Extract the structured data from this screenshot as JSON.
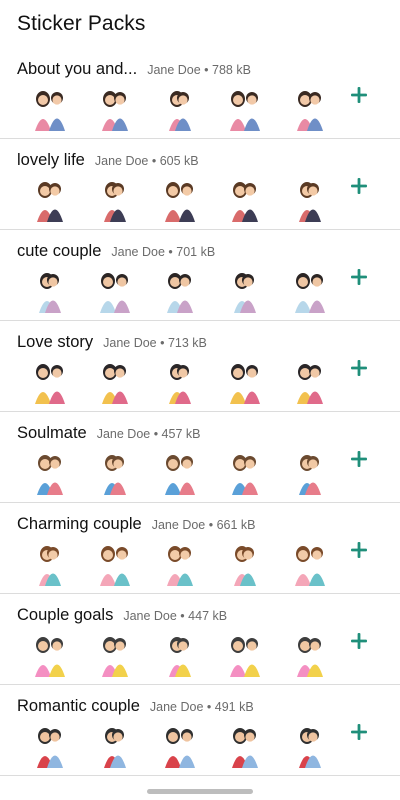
{
  "header": {
    "title": "Sticker Packs"
  },
  "colors": {
    "accent": "#1f8f7a",
    "divider": "#dcdcdc",
    "meta_text": "#6b6b6b"
  },
  "packs": [
    {
      "name": "About you and...",
      "publisher": "Jane Doe",
      "size": "788 kB",
      "meta": "Jane Doe • 788 kB",
      "add_icon": "plus-icon"
    },
    {
      "name": "lovely life",
      "publisher": "Jane Doe",
      "size": "605 kB",
      "meta": "Jane Doe • 605 kB",
      "add_icon": "plus-icon"
    },
    {
      "name": "cute couple",
      "publisher": "Jane Doe",
      "size": "701 kB",
      "meta": "Jane Doe • 701 kB",
      "add_icon": "plus-icon"
    },
    {
      "name": "Love story",
      "publisher": "Jane Doe",
      "size": "713 kB",
      "meta": "Jane Doe • 713 kB",
      "add_icon": "plus-icon"
    },
    {
      "name": "Soulmate",
      "publisher": "Jane Doe",
      "size": "457 kB",
      "meta": "Jane Doe • 457 kB",
      "add_icon": "plus-icon"
    },
    {
      "name": "Charming couple",
      "publisher": "Jane Doe",
      "size": "661 kB",
      "meta": "Jane Doe • 661 kB",
      "add_icon": "plus-icon"
    },
    {
      "name": "Couple goals",
      "publisher": "Jane Doe",
      "size": "447 kB",
      "meta": "Jane Doe • 447 kB",
      "add_icon": "plus-icon"
    },
    {
      "name": "Romantic couple",
      "publisher": "Jane Doe",
      "size": "491 kB",
      "meta": "Jane Doe • 491 kB",
      "add_icon": "plus-icon"
    }
  ]
}
